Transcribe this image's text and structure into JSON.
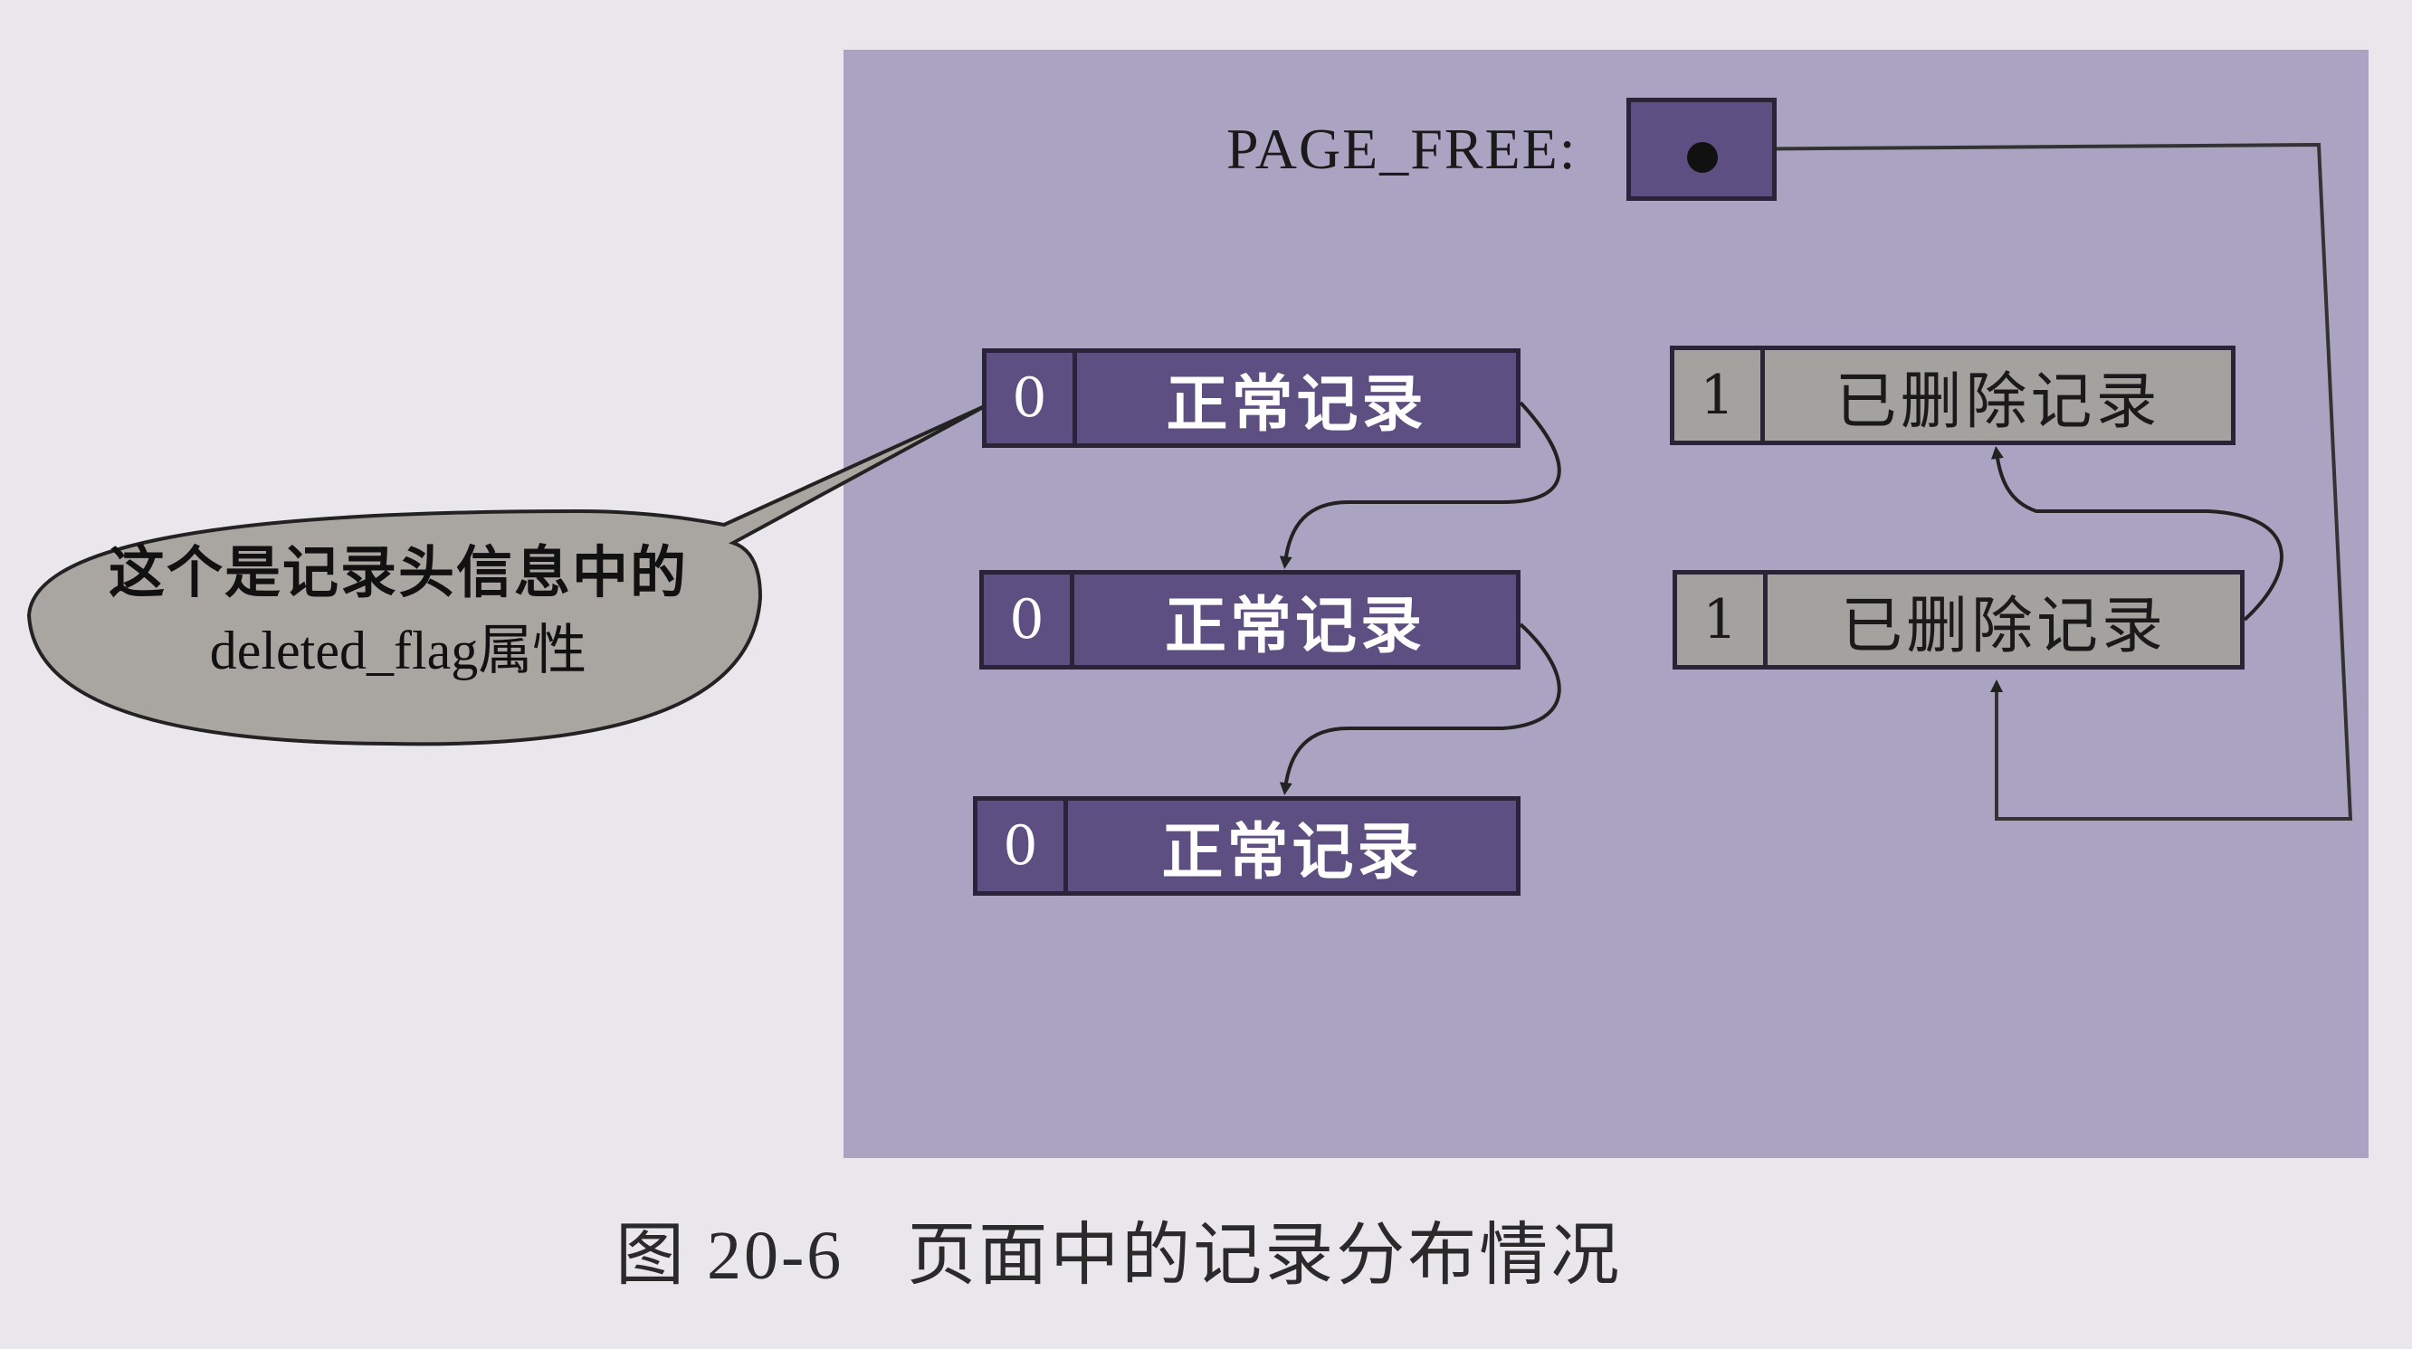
{
  "page_free": {
    "label": "PAGE_FREE:"
  },
  "records": {
    "normal": [
      {
        "flag": "0",
        "label": "正常记录"
      },
      {
        "flag": "0",
        "label": "正常记录"
      },
      {
        "flag": "0",
        "label": "正常记录"
      }
    ],
    "deleted": [
      {
        "flag": "1",
        "label": "已删除记录"
      },
      {
        "flag": "1",
        "label": "已删除记录"
      }
    ]
  },
  "callout": {
    "line1": "这个是记录头信息中的",
    "line2": "deleted_flag属性"
  },
  "caption": {
    "number": "图 20-6",
    "title": "页面中的记录分布情况"
  },
  "colors": {
    "panel": "#aaa3c2",
    "normal_record": "#5e4f82",
    "deleted_record": "#a4a29f",
    "callout_fill": "#a9a6a1"
  }
}
